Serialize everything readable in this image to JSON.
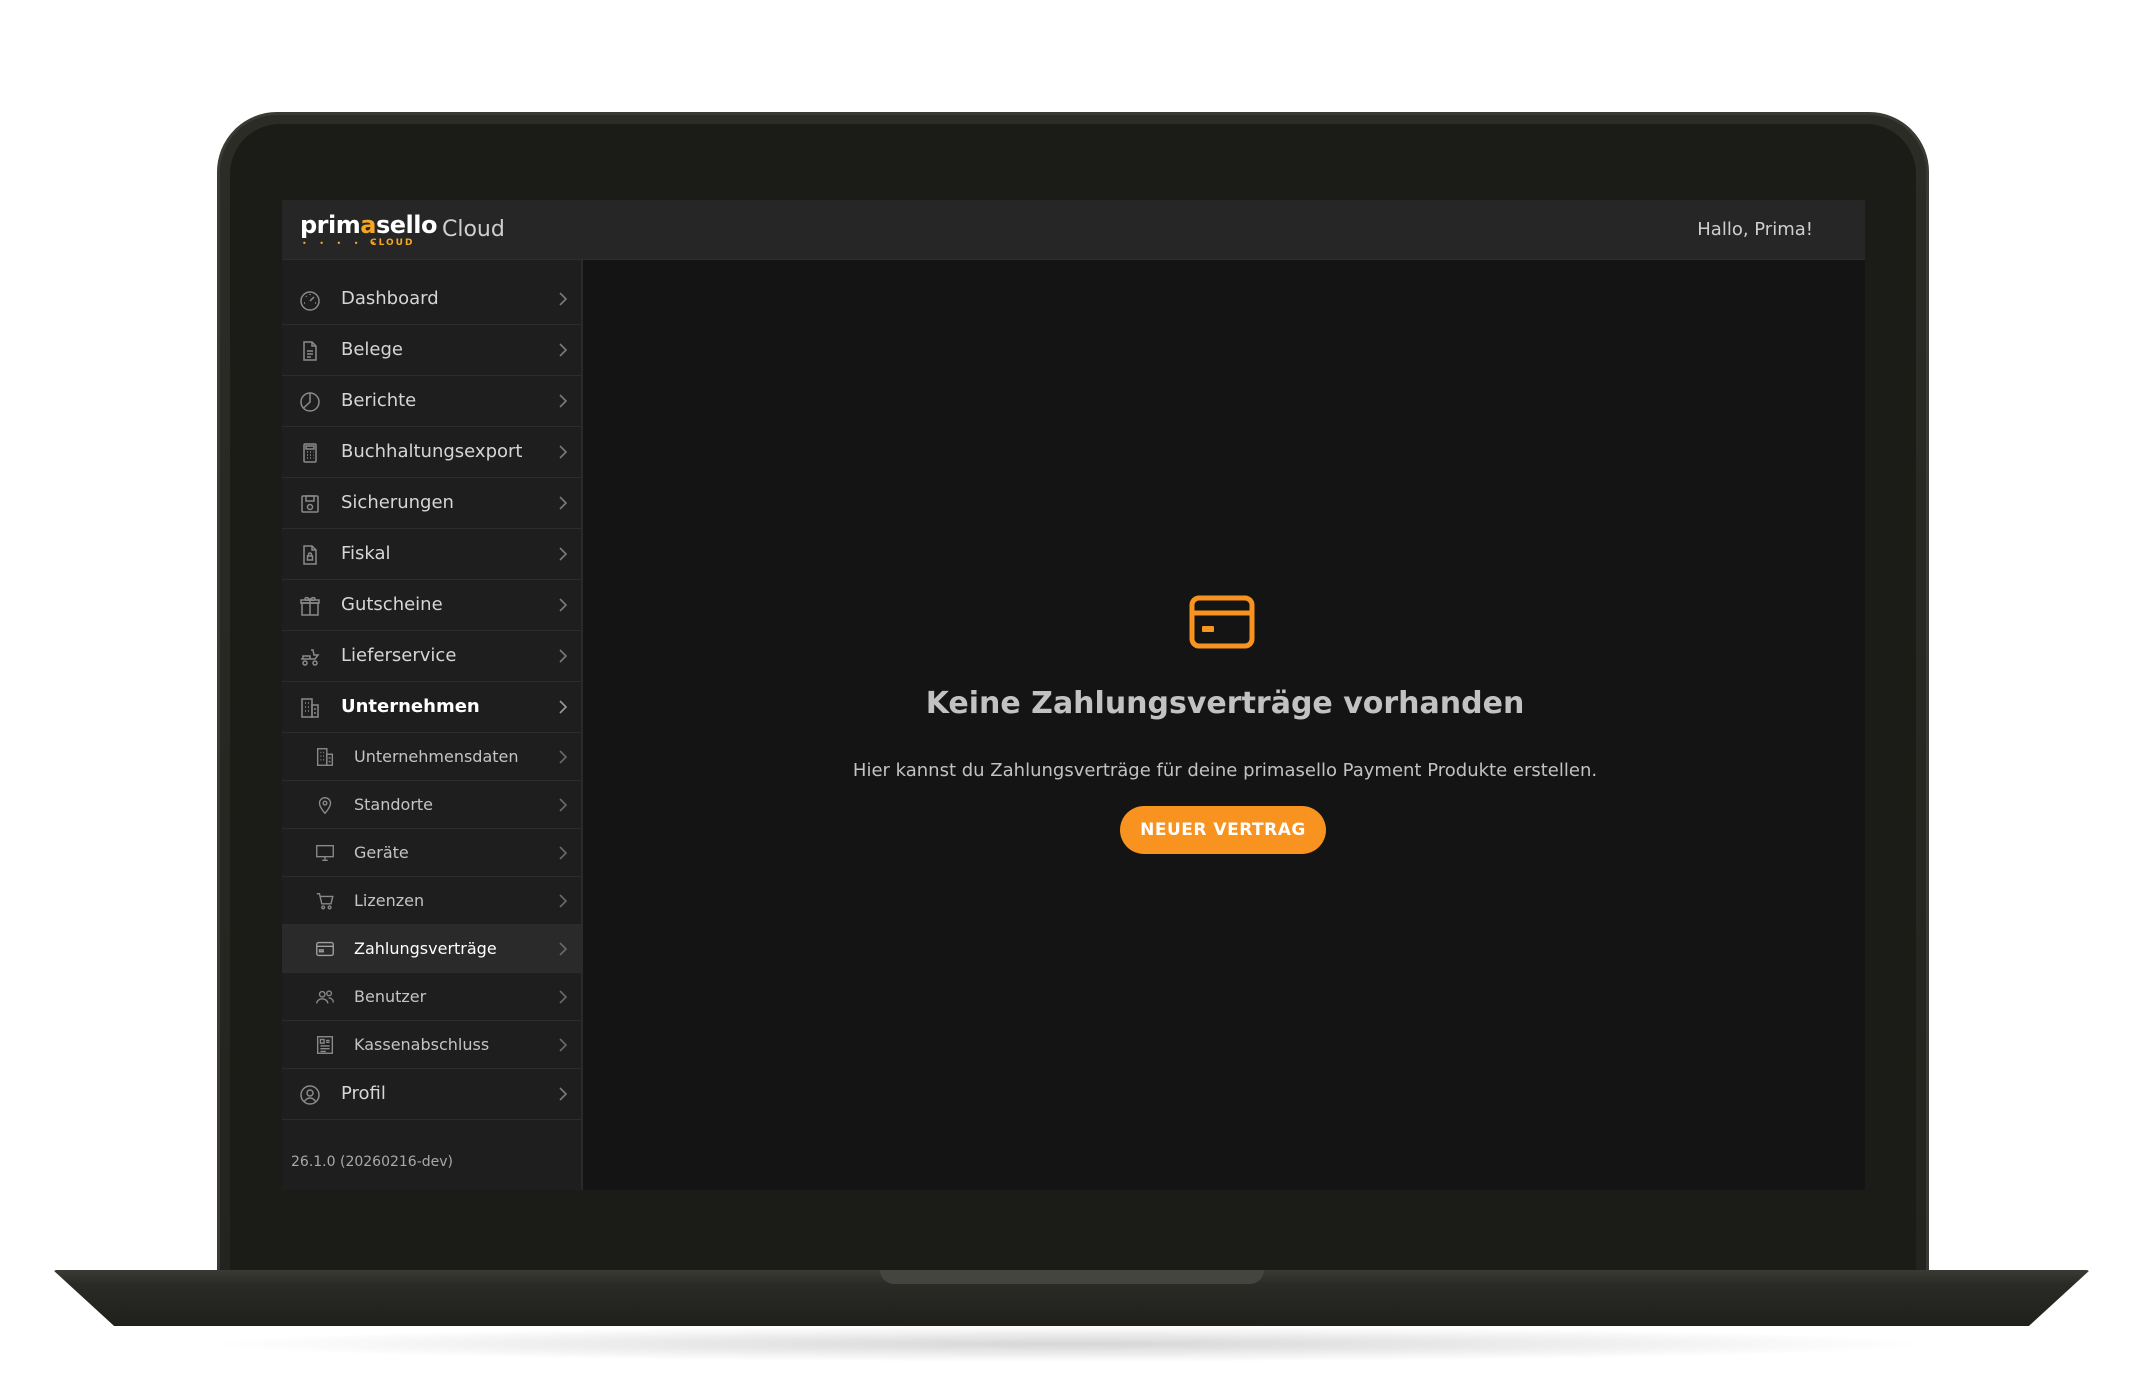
{
  "header": {
    "brand_main": "prim",
    "brand_accent": "a",
    "brand_tail": "sello",
    "brand_sub": "CLOUD",
    "app_title": "Cloud",
    "greeting": "Hallo, Prima!"
  },
  "sidebar": {
    "items": [
      {
        "label": "Dashboard",
        "icon": "gauge-icon"
      },
      {
        "label": "Belege",
        "icon": "document-icon"
      },
      {
        "label": "Berichte",
        "icon": "pie-chart-icon"
      },
      {
        "label": "Buchhaltungsexport",
        "icon": "calculator-icon"
      },
      {
        "label": "Sicherungen",
        "icon": "save-icon"
      },
      {
        "label": "Fiskal",
        "icon": "locked-document-icon"
      },
      {
        "label": "Gutscheine",
        "icon": "gift-icon"
      },
      {
        "label": "Lieferservice",
        "icon": "delivery-icon"
      },
      {
        "label": "Unternehmen",
        "icon": "building-icon"
      }
    ],
    "sub_items": [
      {
        "label": "Unternehmensdaten",
        "icon": "building-icon"
      },
      {
        "label": "Standorte",
        "icon": "location-pin-icon"
      },
      {
        "label": "Geräte",
        "icon": "monitor-icon"
      },
      {
        "label": "Lizenzen",
        "icon": "cart-icon"
      },
      {
        "label": "Zahlungsverträge",
        "icon": "credit-card-icon"
      },
      {
        "label": "Benutzer",
        "icon": "users-icon"
      },
      {
        "label": "Kassenabschluss",
        "icon": "report-icon"
      }
    ],
    "profile": {
      "label": "Profil",
      "icon": "user-circle-icon"
    },
    "version": "26.1.0 (20260216-dev)"
  },
  "main": {
    "empty_icon": "credit-card-icon",
    "title": "Keine Zahlungsverträge vorhanden",
    "description": "Hier kannst du Zahlungsverträge für deine primasello Payment Produkte erstellen.",
    "button_label": "NEUER VERTRAG"
  },
  "colors": {
    "accent": "#f7931e",
    "background": "#141414",
    "sidebar": "#1e1e1e",
    "topbar": "#262626"
  }
}
